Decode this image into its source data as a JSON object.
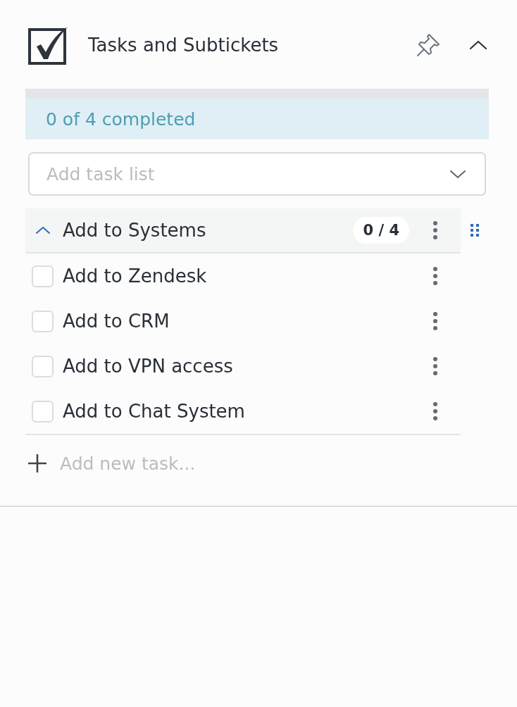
{
  "header": {
    "title": "Tasks and Subtickets",
    "expanded": true
  },
  "progress": {
    "label": "0 of 4 completed"
  },
  "task_list_select": {
    "placeholder": "Add task list"
  },
  "groups": [
    {
      "title": "Add to Systems",
      "expanded": true,
      "count": "0 / 4",
      "tasks": [
        {
          "label": "Add to Zendesk",
          "checked": false
        },
        {
          "label": "Add to CRM",
          "checked": false
        },
        {
          "label": "Add to VPN access",
          "checked": false
        },
        {
          "label": "Add to Chat System",
          "checked": false
        }
      ]
    }
  ],
  "new_task": {
    "placeholder": "Add new task..."
  }
}
